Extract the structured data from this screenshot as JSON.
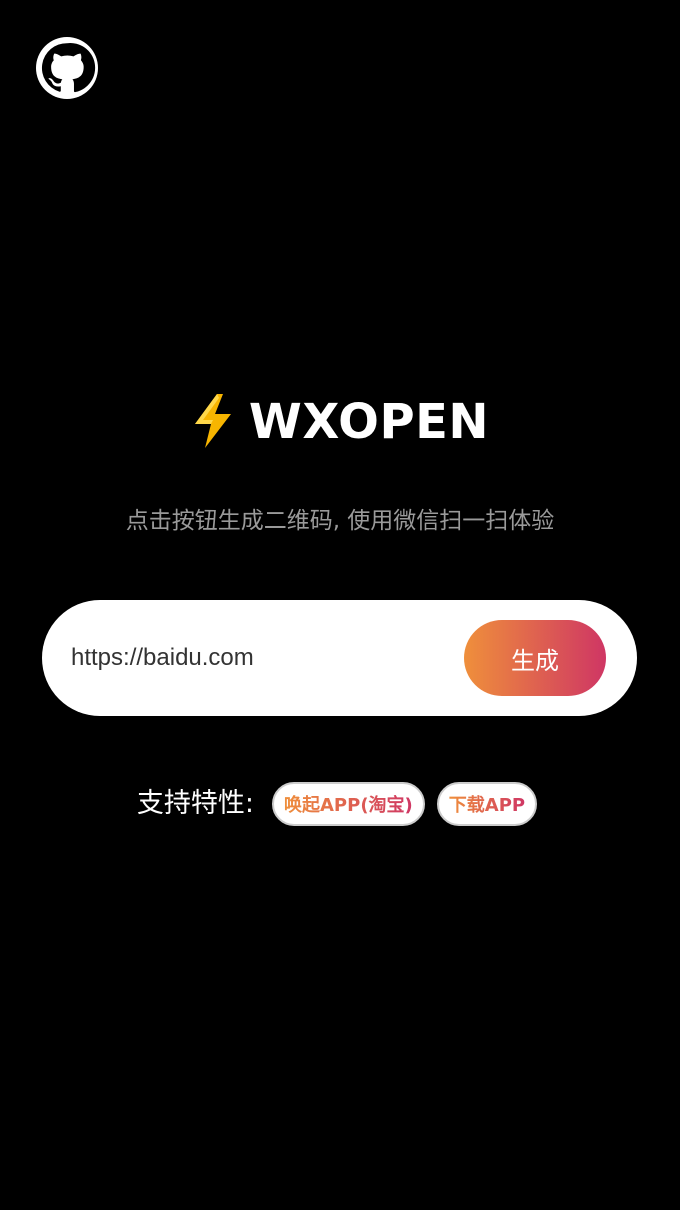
{
  "header": {
    "github_icon": "github-icon"
  },
  "hero": {
    "bolt_icon": "lightning-bolt-icon",
    "title": "WXOPEN",
    "subtitle": "点击按钮生成二维码, 使用微信扫一扫体验"
  },
  "form": {
    "url_value": "https://baidu.com",
    "generate_label": "生成"
  },
  "features": {
    "label": "支持特性:",
    "tags": [
      "唤起APP(淘宝)",
      "下载APP"
    ]
  },
  "colors": {
    "background": "#000000",
    "accent_start": "#ef8f3b",
    "accent_end": "#cf3664"
  }
}
